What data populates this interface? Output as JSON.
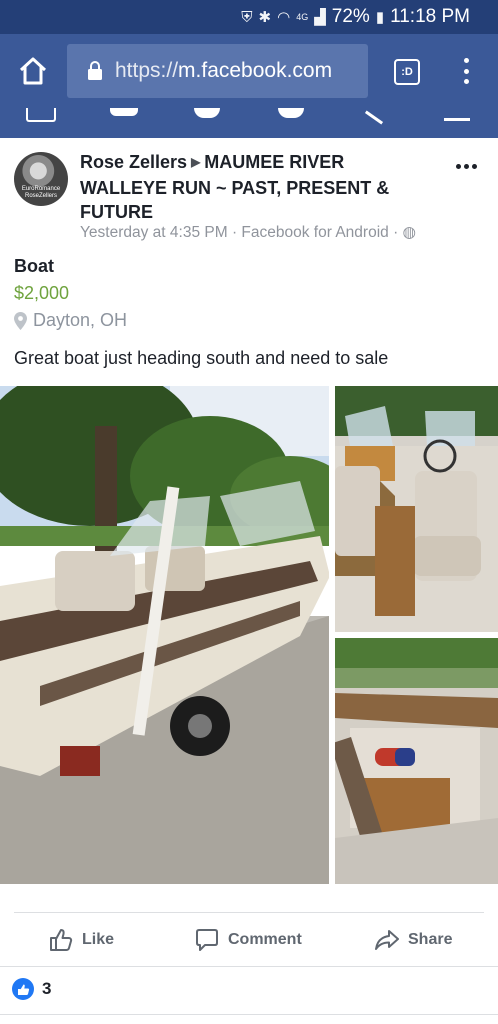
{
  "status_bar": {
    "battery": "72%",
    "time": "11:18 PM",
    "network": "4G"
  },
  "browser": {
    "url_scheme": "https://",
    "url_host": "m.facebook.com",
    "tabs_label": ":D",
    "icons": [
      "home-icon",
      "lock-icon",
      "tabs-icon",
      "more-vert-icon"
    ]
  },
  "post": {
    "author": "Rose Zellers",
    "group": "MAUMEE RIVER WALLEYE RUN ~ PAST, PRESENT & FUTURE",
    "timestamp": "Yesterday at 4:35 PM",
    "via": "Facebook for Android",
    "avatar_text": "EuroRomance RoseZellers"
  },
  "listing": {
    "title": "Boat",
    "price": "$2,000",
    "location": "Dayton, OH",
    "description": "Great boat just heading south and need to sale"
  },
  "actions": {
    "like": "Like",
    "comment": "Comment",
    "share": "Share"
  },
  "reactions": {
    "count": "3"
  },
  "colors": {
    "fb_blue": "#3b5998",
    "status_bar": "#243f77",
    "price_green": "#6fa33e",
    "like_blue": "#2078f4"
  }
}
